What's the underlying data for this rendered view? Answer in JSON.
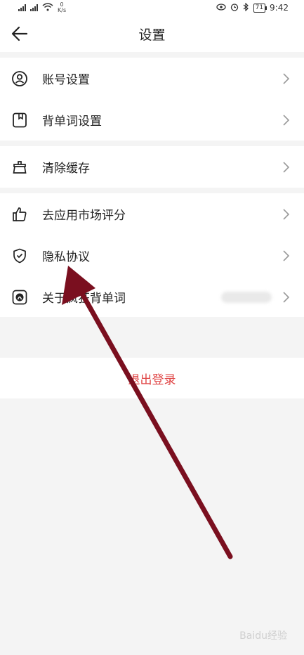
{
  "status_bar": {
    "network_speed_value": "0",
    "network_speed_unit": "K/s",
    "battery": "71",
    "time": "9:42"
  },
  "header": {
    "title": "设置"
  },
  "groups": [
    {
      "items": [
        {
          "label": "账号设置",
          "icon": "user-icon"
        },
        {
          "label": "背单词设置",
          "icon": "book-icon"
        }
      ]
    },
    {
      "items": [
        {
          "label": "清除缓存",
          "icon": "broom-icon"
        }
      ]
    },
    {
      "items": [
        {
          "label": "去应用市场评分",
          "icon": "thumbs-up-icon"
        },
        {
          "label": "隐私协议",
          "icon": "shield-check-icon"
        },
        {
          "label": "关于疯狂背单词",
          "icon": "app-logo-icon"
        }
      ]
    }
  ],
  "logout_label": "退出登录",
  "colors": {
    "logout_text": "#e04545",
    "annotation_arrow": "#7a0f1f",
    "page_background": "#f4f4f4"
  },
  "watermark": "Baidu经验"
}
